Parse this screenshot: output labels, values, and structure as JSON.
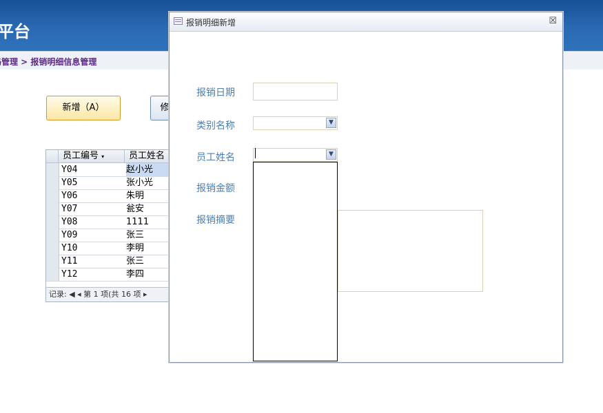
{
  "app": {
    "title_partial": "平台",
    "breadcrumb": "码管理 > 报销明细信息管理"
  },
  "toolbar": {
    "add_label": "新增（A）",
    "second_partial": "修"
  },
  "grid": {
    "columns": [
      "员工编号",
      "员工姓名"
    ],
    "rows": [
      {
        "id": "Y04",
        "name": "赵小光"
      },
      {
        "id": "Y05",
        "name": "张小光"
      },
      {
        "id": "Y06",
        "name": "朱明"
      },
      {
        "id": "Y07",
        "name": "瓮安"
      },
      {
        "id": "Y08",
        "name": "1111"
      },
      {
        "id": "Y09",
        "name": "张三"
      },
      {
        "id": "Y10",
        "name": "李明"
      },
      {
        "id": "Y11",
        "name": "张三"
      },
      {
        "id": "Y12",
        "name": "李四"
      }
    ],
    "record_nav": "记录: ◀ ◂ 第 1 项(共 16 项 ▸"
  },
  "dialog": {
    "title": "报销明细新增",
    "close_glyph": "☒",
    "fields": {
      "date_label": "报销日期",
      "category_label": "类别名称",
      "employee_label": "员工姓名",
      "amount_label": "报销金额",
      "summary_label": "报销摘要"
    }
  }
}
